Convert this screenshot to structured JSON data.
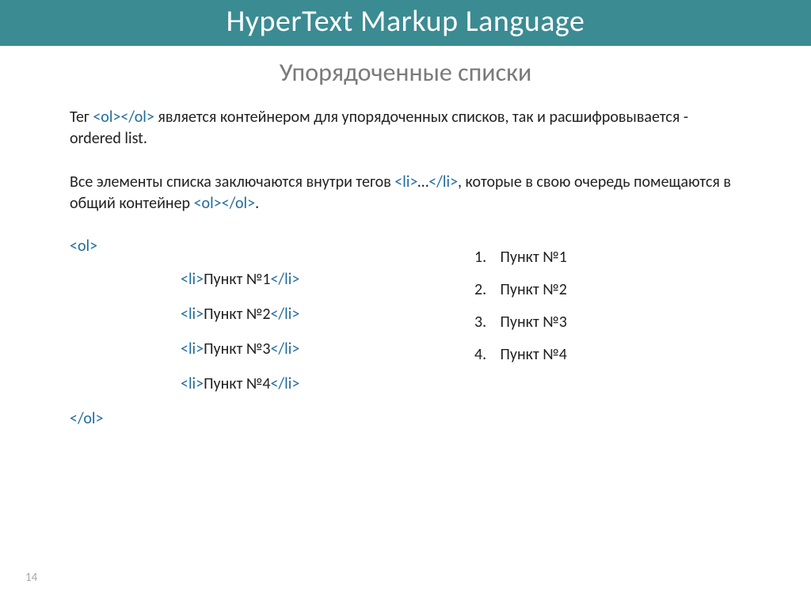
{
  "header": {
    "title": "HyperText Markup Language"
  },
  "subtitle": "Упорядоченные списки",
  "para1": {
    "prefix": "Тег ",
    "tag": "<ol></ol>",
    "rest": " является контейнером для упорядоченных списков, так и расшифровывается - ordered list."
  },
  "para2": {
    "p1": "Все элементы списка заключаются внутри тегов ",
    "tag1": "<li>",
    "mid": "…",
    "tag2": "</li>",
    "p2": ", которые в свою очередь помещаются в общий контейнер ",
    "tag3": "<ol></ol>",
    "p3": "."
  },
  "code": {
    "ol_open": "<ol>",
    "ol_close": "</ol>",
    "li_open": "<li>",
    "li_close": "</li>",
    "items": [
      "Пункт №1",
      "Пункт №2",
      "Пункт №3",
      "Пункт №4"
    ]
  },
  "output": {
    "items": [
      {
        "num": "1.",
        "text": "Пункт №1"
      },
      {
        "num": "2.",
        "text": "Пункт №2"
      },
      {
        "num": "3.",
        "text": "Пункт №3"
      },
      {
        "num": "4.",
        "text": "Пункт №4"
      }
    ]
  },
  "page_number": "14"
}
